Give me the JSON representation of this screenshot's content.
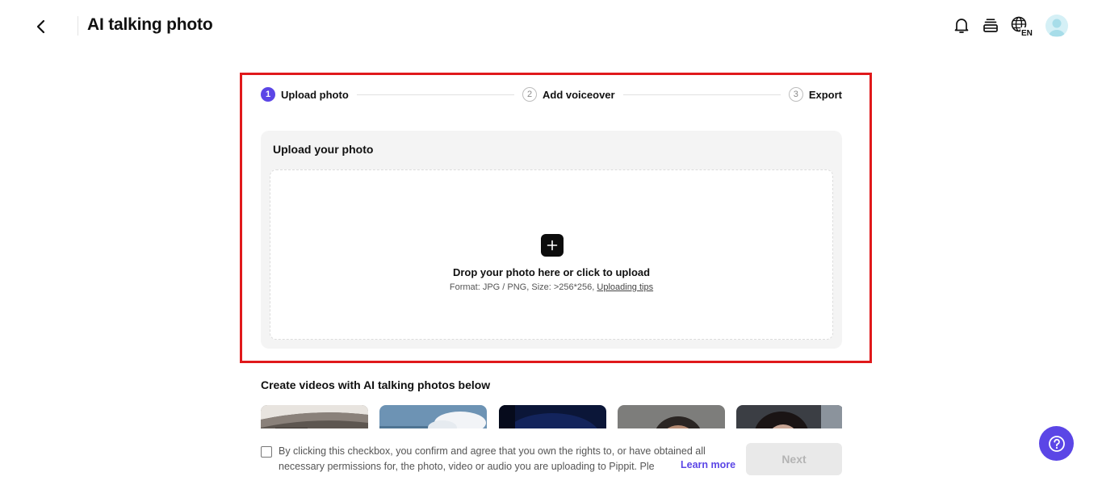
{
  "header": {
    "title": "AI talking photo",
    "language_badge": "EN"
  },
  "stepper": {
    "steps": [
      {
        "number": "1",
        "label": "Upload photo"
      },
      {
        "number": "2",
        "label": "Add voiceover"
      },
      {
        "number": "3",
        "label": "Export"
      }
    ],
    "active_step": 1
  },
  "upload": {
    "title": "Upload your photo",
    "drop_text": "Drop your photo here or click to upload",
    "format_text": "Format: JPG / PNG, Size: >256*256,",
    "tips_link": "Uploading tips"
  },
  "examples": {
    "title": "Create videos with AI talking photos below"
  },
  "consent": {
    "text_line1": "By clicking this checkbox, you confirm and agree that you own the rights to, or have obtained all",
    "text_line2": "necessary permissions for, the photo, video or audio you are uploading to Pippit. Ple",
    "learn_more": "Learn more",
    "checked": false
  },
  "actions": {
    "next_label": "Next"
  },
  "colors": {
    "accent": "#5b46e6",
    "highlight": "#e0191b"
  }
}
